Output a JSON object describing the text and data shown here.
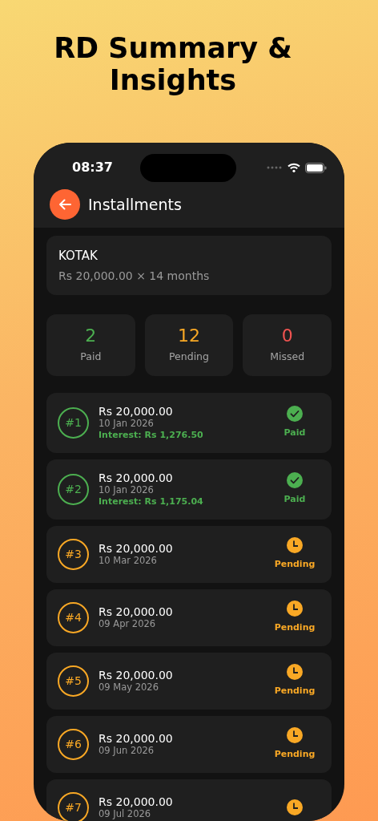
{
  "title": "RD Summary & Insights",
  "status_bar": {
    "time": "08:37"
  },
  "header": {
    "title": "Installments"
  },
  "account": {
    "name": "KOTAK",
    "detail": "Rs 20,000.00 × 14 months"
  },
  "stats": [
    {
      "value": "2",
      "label": "Paid",
      "kind": "paid"
    },
    {
      "value": "12",
      "label": "Pending",
      "kind": "pending"
    },
    {
      "value": "0",
      "label": "Missed",
      "kind": "missed"
    }
  ],
  "installments": [
    {
      "number": "#1",
      "amount": "Rs 20,000.00",
      "date": "10 Jan 2026",
      "interest": "Interest: Rs 1,276.50",
      "status": "Paid",
      "kind": "paid"
    },
    {
      "number": "#2",
      "amount": "Rs 20,000.00",
      "date": "10 Jan 2026",
      "interest": "Interest: Rs 1,175.04",
      "status": "Paid",
      "kind": "paid"
    },
    {
      "number": "#3",
      "amount": "Rs 20,000.00",
      "date": "10 Mar 2026",
      "status": "Pending",
      "kind": "pending"
    },
    {
      "number": "#4",
      "amount": "Rs 20,000.00",
      "date": "09 Apr 2026",
      "status": "Pending",
      "kind": "pending"
    },
    {
      "number": "#5",
      "amount": "Rs 20,000.00",
      "date": "09 May 2026",
      "status": "Pending",
      "kind": "pending"
    },
    {
      "number": "#6",
      "amount": "Rs 20,000.00",
      "date": "09 Jun 2026",
      "status": "Pending",
      "kind": "pending"
    },
    {
      "number": "#7",
      "amount": "Rs 20,000.00",
      "date": "09 Jul 2026",
      "kind": "pending"
    }
  ]
}
